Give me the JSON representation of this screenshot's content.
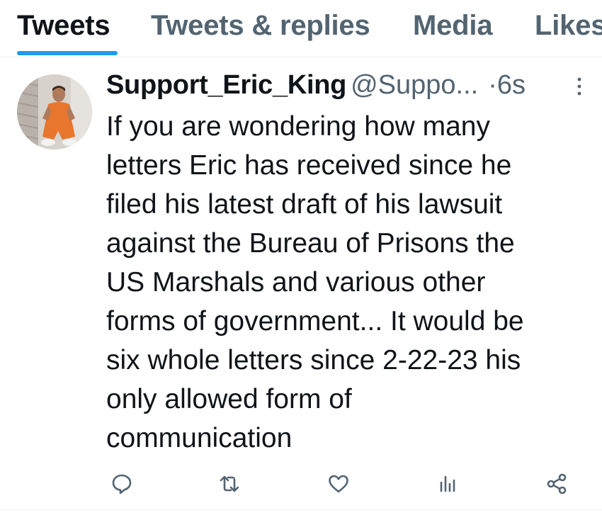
{
  "tabs": [
    {
      "label": "Tweets",
      "active": true
    },
    {
      "label": "Tweets & replies",
      "active": false
    },
    {
      "label": "Media",
      "active": false
    },
    {
      "label": "Likes",
      "active": false
    }
  ],
  "tweet": {
    "display_name": "Support_Eric_King",
    "handle": "@Suppo...",
    "separator": "·",
    "time": "6s",
    "text": "If you are wondering how many\nletters Eric has received since he\nfiled his latest draft of his lawsuit\nagainst the Bureau of Prisons the\nUS Marshals and various other\nforms of government... It would be\nsix whole letters since 2-22-23 his\nonly allowed form of\ncommunication"
  },
  "actions": [
    "reply-icon",
    "retweet-icon",
    "like-icon",
    "views-icon",
    "share-icon"
  ],
  "colors": {
    "accent": "#1d9bf0",
    "text_primary": "#0f1419",
    "text_secondary": "#536471",
    "divider": "#eff3f4",
    "avatar_orange": "#e8762c"
  }
}
